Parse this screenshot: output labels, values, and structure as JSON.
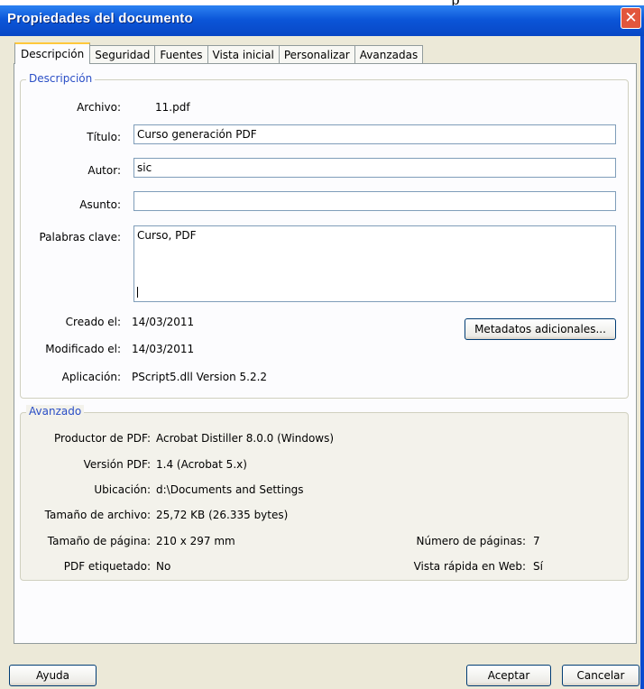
{
  "window": {
    "title": "Propiedades del documento",
    "close_glyph": "✕",
    "top_sliver_text": "p"
  },
  "tabs": [
    {
      "label": "Descripción",
      "active": true
    },
    {
      "label": "Seguridad",
      "active": false
    },
    {
      "label": "Fuentes",
      "active": false
    },
    {
      "label": "Vista inicial",
      "active": false
    },
    {
      "label": "Personalizar",
      "active": false
    },
    {
      "label": "Avanzadas",
      "active": false
    }
  ],
  "descripcion": {
    "legend": "Descripción",
    "archivo_label": "Archivo:",
    "archivo_value": "11.pdf",
    "titulo_label": "Título:",
    "titulo_value": "Curso generación PDF",
    "autor_label": "Autor:",
    "autor_value": "sic",
    "asunto_label": "Asunto:",
    "asunto_value": "",
    "palabras_label": "Palabras clave:",
    "palabras_value": "Curso, PDF",
    "creado_label": "Creado el:",
    "creado_value": "14/03/2011",
    "modificado_label": "Modificado el:",
    "modificado_value": "14/03/2011",
    "aplicacion_label": "Aplicación:",
    "aplicacion_value": "PScript5.dll Version 5.2.2",
    "metadatos_button": "Metadatos adicionales..."
  },
  "avanzado": {
    "legend": "Avanzado",
    "productor_label": "Productor de PDF:",
    "productor_value": "Acrobat Distiller 8.0.0 (Windows)",
    "version_label": "Versión PDF:",
    "version_value": "1.4 (Acrobat 5.x)",
    "ubicacion_label": "Ubicación:",
    "ubicacion_value": "d:\\Documents and Settings",
    "tamano_archivo_label": "Tamaño de archivo:",
    "tamano_archivo_value": "25,72 KB (26.335 bytes)",
    "tamano_pagina_label": "Tamaño de página:",
    "tamano_pagina_value": "210 x 297 mm",
    "numero_paginas_label": "Número de páginas:",
    "numero_paginas_value": "7",
    "etiquetado_label": "PDF etiquetado:",
    "etiquetado_value": "No",
    "vista_rapida_label": "Vista rápida en Web:",
    "vista_rapida_value": "Sí"
  },
  "buttons": {
    "ayuda": "Ayuda",
    "aceptar": "Aceptar",
    "cancelar": "Cancelar"
  },
  "colors": {
    "titlebar": "#0b55d8",
    "window_bg": "#ece9d8",
    "legend_text": "#2a4ec6",
    "close_button": "#e2563c",
    "active_tab_accent": "#ffc83c"
  }
}
